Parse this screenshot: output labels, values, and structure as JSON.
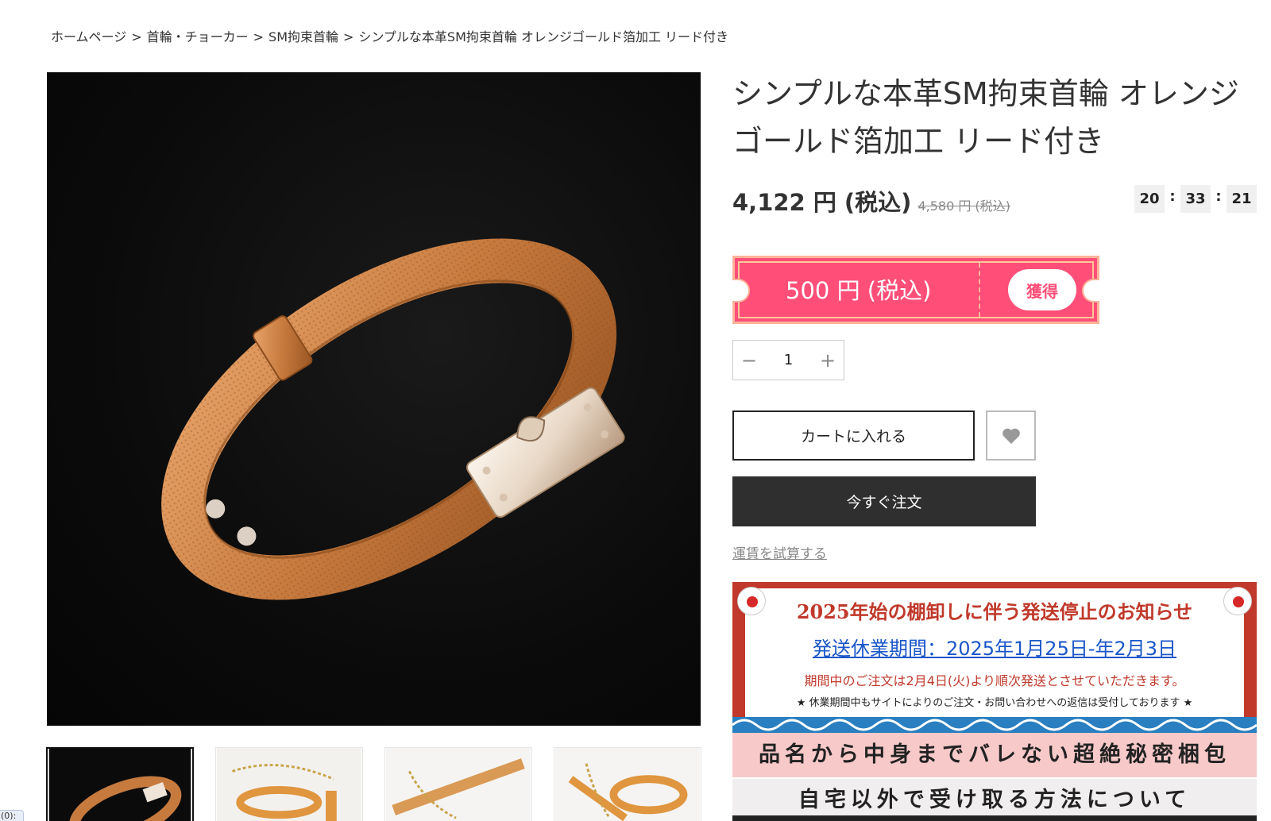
{
  "breadcrumb": {
    "items": [
      "ホームページ",
      "首輪・チョーカー",
      "SM拘束首輪",
      "シンプルな本革SM拘束首輪 オレンジゴールド箔加工 リード付き"
    ],
    "separator": ">"
  },
  "product": {
    "title": "シンプルな本革SM拘束首輪 オレンジゴールド箔加工 リード付き",
    "price": "4,122 円 (税込)",
    "original_price": "4,580 円 (税込)",
    "countdown": {
      "hours": "20",
      "minutes": "33",
      "seconds": "21",
      "separator": ":"
    }
  },
  "coupon": {
    "amount": "500 円 (税込)",
    "get_label": "獲得",
    "color": "#ff4f78"
  },
  "quantity": {
    "value": "1",
    "minus_icon": "minus-icon",
    "plus_icon": "plus-icon"
  },
  "actions": {
    "add_to_cart": "カートに入れる",
    "favorite_icon": "heart-icon",
    "buy_now": "今すぐ注文",
    "shipping_calc": "運賃を試算する"
  },
  "banner": {
    "title": "2025年始の棚卸しに伴う発送停止のお知らせ",
    "period": "発送休業期間：2025年1月25日-年2月3日",
    "note1": "期間中のご注文は2月4日(火)より順次発送とさせていただきます。",
    "note2": "★ 休業期間中もサイトによりのご注文・お問い合わせへの返信は受付しております ★",
    "secret_packaging": "品名から中身までバレない超絶秘密梱包",
    "receive_elsewhere": "自宅以外で受け取る方法について"
  },
  "gallery": {
    "thumbnail_count": 4
  },
  "misc": {
    "corner_tag": "(0):"
  },
  "colors": {
    "accent_pink": "#ff4f78",
    "dark_button": "#2f2f2f",
    "banner_red": "#c0392b",
    "link_blue": "#1a56c8"
  }
}
